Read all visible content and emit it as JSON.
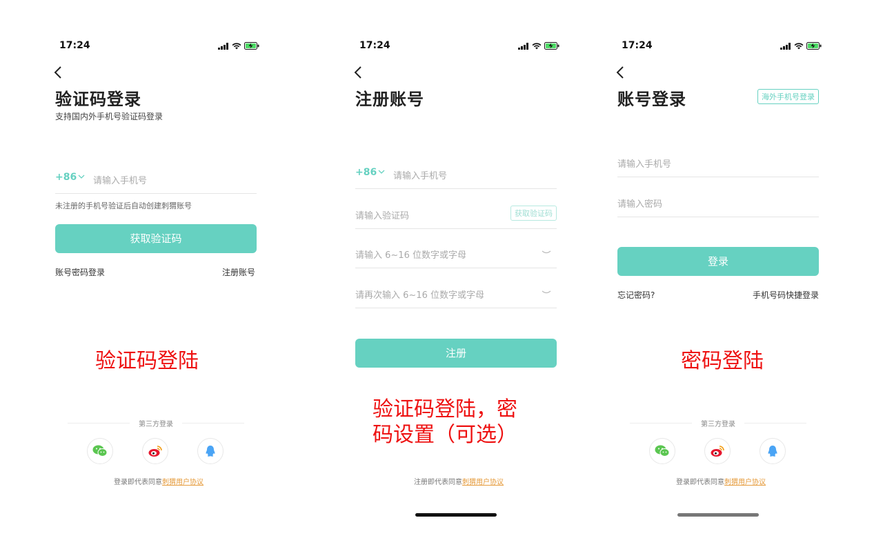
{
  "status": {
    "time": "17:24"
  },
  "screen1": {
    "title": "验证码登录",
    "subtitle": "支持国内外手机号验证码登录",
    "country_code": "+86",
    "phone_placeholder": "请输入手机号",
    "hint": "未注册的手机号验证后自动创建刺猬账号",
    "submit_label": "获取验证码",
    "left_link": "账号密码登录",
    "right_link": "注册账号",
    "annotation": "验证码登陆",
    "third_party_label": "第三方登录",
    "terms_prefix": "登录即代表同意",
    "terms_link": "刺猬用户协议"
  },
  "screen2": {
    "title": "注册账号",
    "country_code": "+86",
    "phone_placeholder": "请输入手机号",
    "code_placeholder": "请输入验证码",
    "get_code_label": "获取验证码",
    "password_placeholder": "请输入 6~16 位数字或字母",
    "confirm_placeholder": "请再次输入 6~16 位数字或字母",
    "submit_label": "注册",
    "annotation_line1": "验证码登陆，密",
    "annotation_line2": "码设置（可选）",
    "terms_prefix": "注册即代表同意",
    "terms_link": "刺猬用户协议"
  },
  "screen3": {
    "title": "账号登录",
    "overseas_label": "海外手机号登录",
    "phone_placeholder": "请输入手机号",
    "password_placeholder": "请输入密码",
    "submit_label": "登录",
    "left_link": "忘记密码?",
    "right_link": "手机号码快捷登录",
    "annotation": "密码登陆",
    "third_party_label": "第三方登录",
    "terms_prefix": "登录即代表同意",
    "terms_link": "刺猬用户协议"
  },
  "colors": {
    "accent": "#66d1c1",
    "annotation": "#ee1111",
    "link": "#e59a3a",
    "wechat": "#5bc651",
    "weibo": "#e6162d",
    "qq": "#4aa4f5"
  },
  "icons": [
    "signal-icon",
    "wifi-icon",
    "battery-charging-icon",
    "back-chevron-icon",
    "chevron-down-icon",
    "eye-closed-icon",
    "wechat-icon",
    "weibo-icon",
    "qq-icon"
  ]
}
